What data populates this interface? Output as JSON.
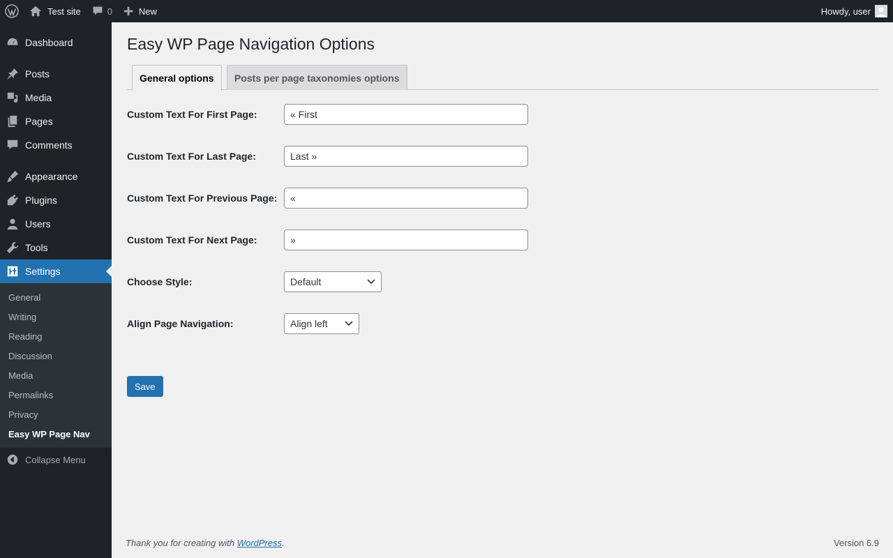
{
  "adminbar": {
    "site_name": "Test site",
    "comments_count": "0",
    "new_label": "New",
    "howdy": "Howdy, user"
  },
  "sidebar": {
    "items": [
      {
        "label": "Dashboard",
        "icon": "dashboard-icon"
      },
      {
        "label": "Posts",
        "icon": "pushpin-icon"
      },
      {
        "label": "Media",
        "icon": "media-icon"
      },
      {
        "label": "Pages",
        "icon": "pages-icon"
      },
      {
        "label": "Comments",
        "icon": "comment-icon"
      },
      {
        "label": "Appearance",
        "icon": "brush-icon"
      },
      {
        "label": "Plugins",
        "icon": "plugin-icon"
      },
      {
        "label": "Users",
        "icon": "users-icon"
      },
      {
        "label": "Tools",
        "icon": "wrench-icon"
      },
      {
        "label": "Settings",
        "icon": "settings-icon"
      }
    ],
    "submenu": [
      "General",
      "Writing",
      "Reading",
      "Discussion",
      "Media",
      "Permalinks",
      "Privacy",
      "Easy WP Page Nav"
    ],
    "collapse_label": "Collapse Menu",
    "accent": "#2271b1"
  },
  "main": {
    "title": "Easy WP Page Navigation Options",
    "tabs": [
      {
        "label": "General options",
        "active": true
      },
      {
        "label": "Posts per page taxonomies options",
        "active": false
      }
    ],
    "fields": {
      "first": {
        "label": "Custom Text For First Page:",
        "value": "« First"
      },
      "last": {
        "label": "Custom Text For Last Page:",
        "value": "Last »"
      },
      "previous": {
        "label": "Custom Text For Previous Page:",
        "value": "«"
      },
      "next": {
        "label": "Custom Text For Next Page:",
        "value": "»"
      },
      "style": {
        "label": "Choose Style:",
        "selected": "Default"
      },
      "align": {
        "label": "Align Page Navigation:",
        "selected": "Align left"
      }
    },
    "save_label": "Save"
  },
  "footer": {
    "thanks_prefix": "Thank you for creating with ",
    "thanks_link": "WordPress",
    "thanks_suffix": ".",
    "version": "Version 6.9"
  }
}
